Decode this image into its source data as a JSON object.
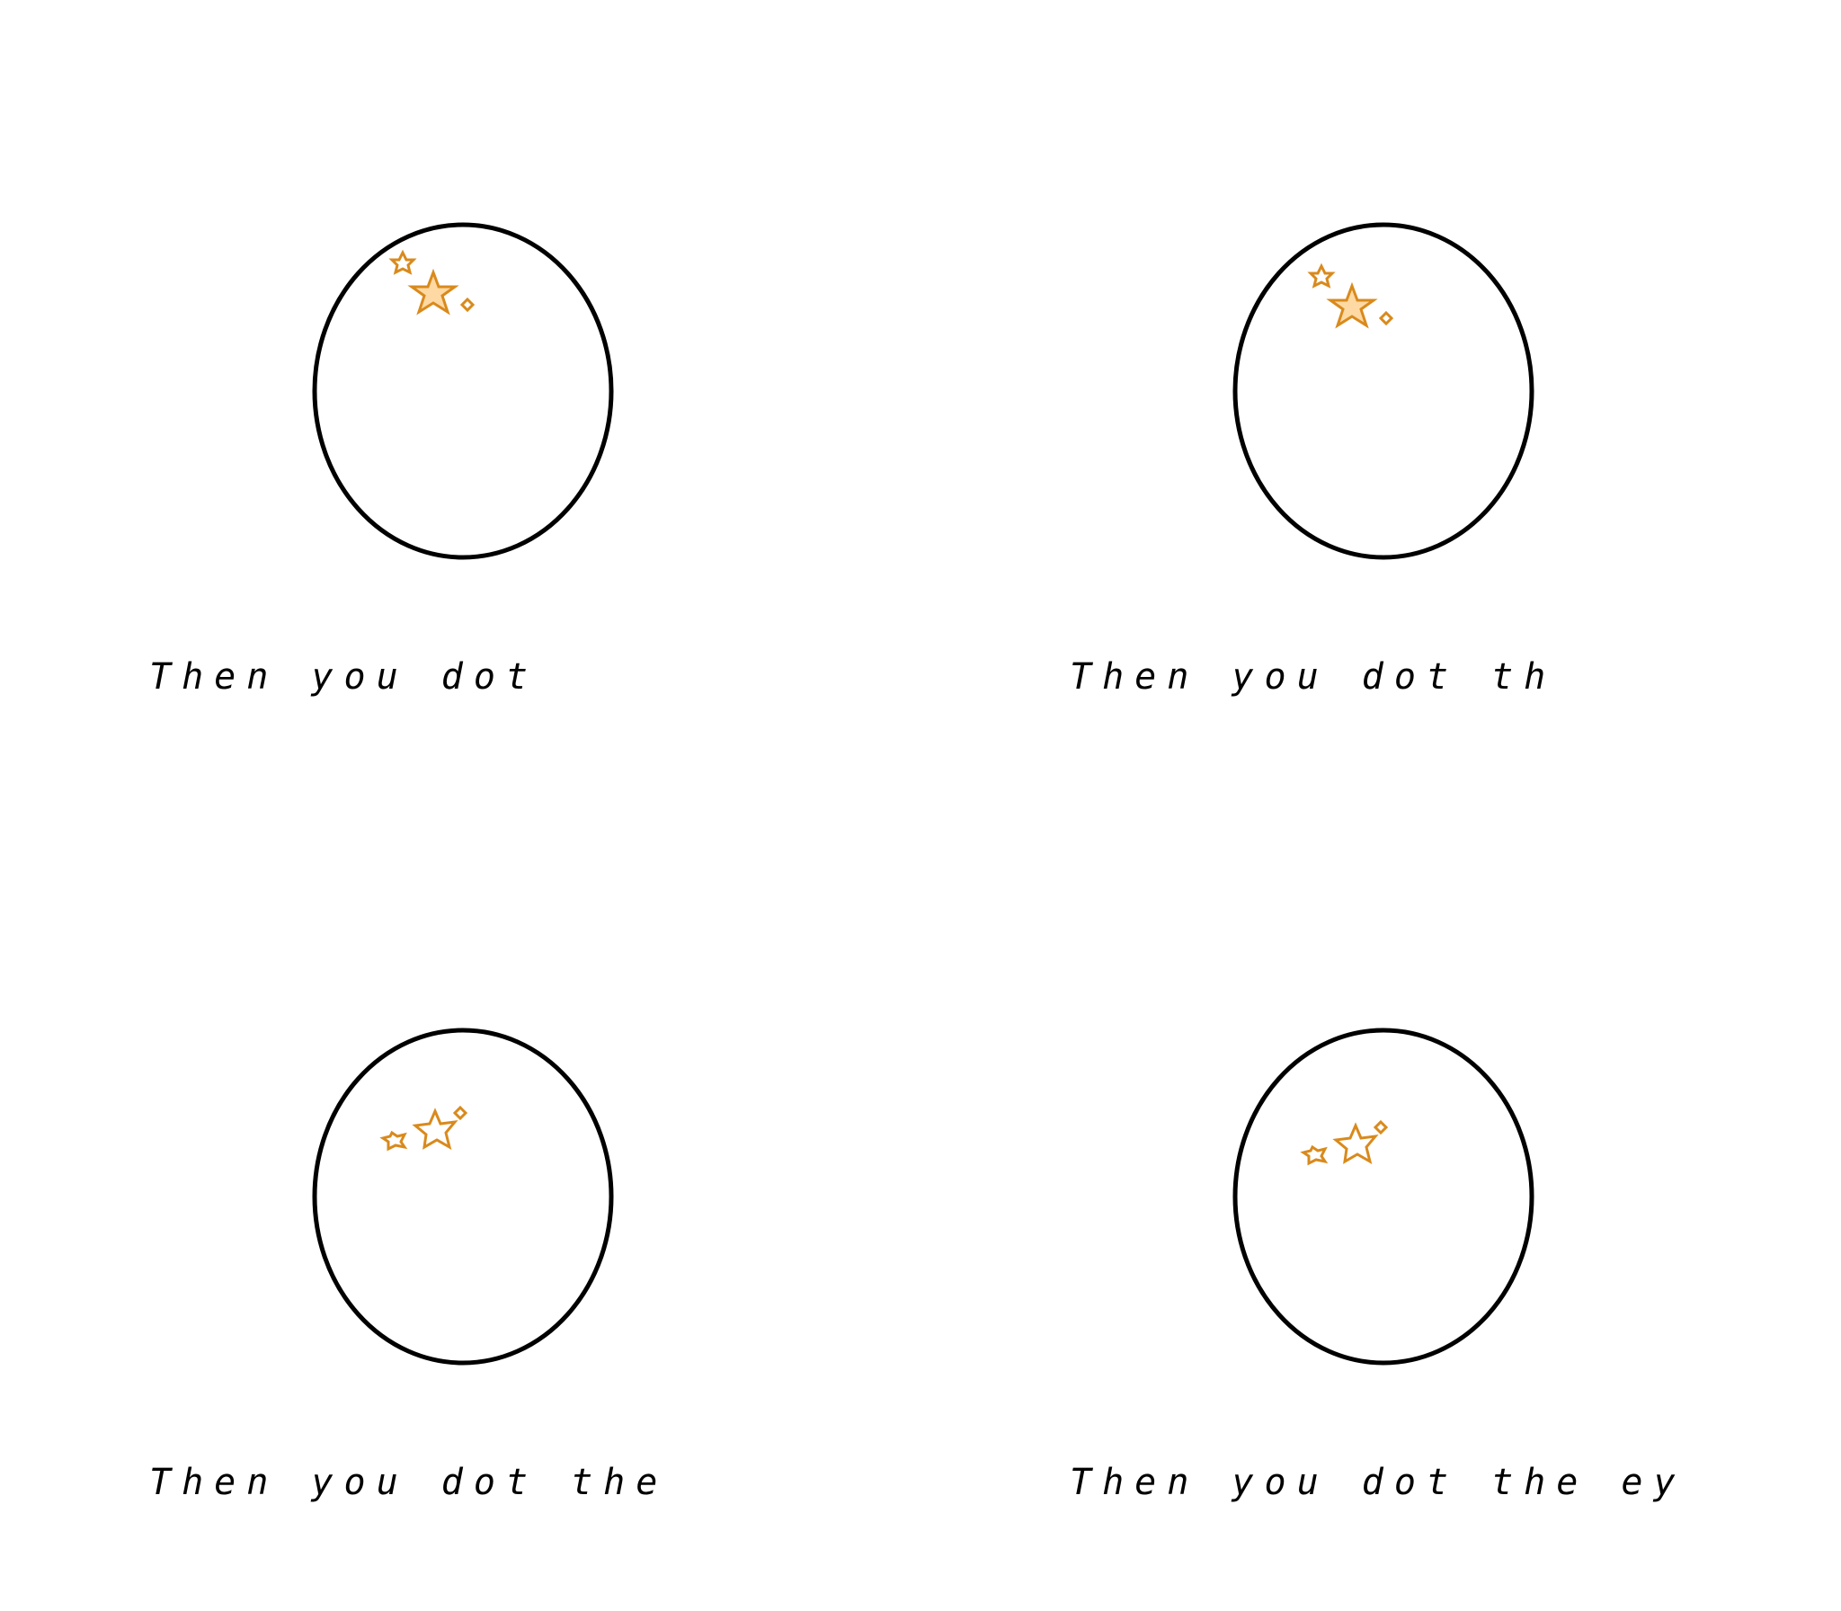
{
  "frames": [
    {
      "caption": "Then you dot",
      "cursor_style": "filled"
    },
    {
      "caption": "Then you dot th",
      "cursor_style": "filled"
    },
    {
      "caption": "Then you dot the",
      "cursor_style": "outline"
    },
    {
      "caption": "Then you dot the ey",
      "cursor_style": "outline"
    }
  ],
  "colors": {
    "background": "#ffffff",
    "outline": "#000000",
    "star_stroke": "#d98a1c",
    "star_fill": "#ffd9a3",
    "text": "#000000"
  },
  "icons": [
    "magic-wand-cursor-icon"
  ]
}
